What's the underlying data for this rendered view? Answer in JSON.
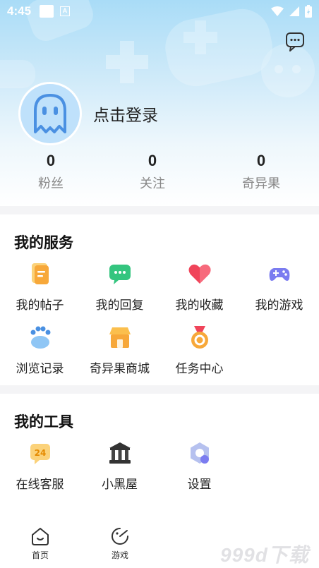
{
  "status_bar": {
    "time": "4:45",
    "notif_badge": "A"
  },
  "profile": {
    "login_text": "点击登录"
  },
  "stats": [
    {
      "value": "0",
      "label": "粉丝"
    },
    {
      "value": "0",
      "label": "关注"
    },
    {
      "value": "0",
      "label": "奇异果"
    }
  ],
  "services": {
    "title": "我的服务",
    "items": [
      {
        "label": "我的帖子",
        "icon": "posts-icon"
      },
      {
        "label": "我的回复",
        "icon": "reply-icon"
      },
      {
        "label": "我的收藏",
        "icon": "heart-icon"
      },
      {
        "label": "我的游戏",
        "icon": "gamepad-icon"
      },
      {
        "label": "浏览记录",
        "icon": "paw-icon"
      },
      {
        "label": "奇异果商城",
        "icon": "shop-icon"
      },
      {
        "label": "任务中心",
        "icon": "medal-icon"
      }
    ]
  },
  "tools": {
    "title": "我的工具",
    "items": [
      {
        "label": "在线客服",
        "icon": "24h-support-icon",
        "badge": "24"
      },
      {
        "label": "小黑屋",
        "icon": "building-icon"
      },
      {
        "label": "设置",
        "icon": "settings-icon"
      }
    ]
  },
  "tabbar": {
    "items": [
      {
        "label": "首页",
        "icon": "home-icon"
      },
      {
        "label": "游戏",
        "icon": "game-icon"
      }
    ]
  },
  "watermark": "999d下载",
  "colors": {
    "header_top": "#a9dcf7",
    "avatar_bg": "#bfe1fb",
    "icon_blue": "#4a90e2",
    "accent_orange": "#f7a83a",
    "accent_green": "#34c57f",
    "accent_red": "#f0445a",
    "accent_purple": "#7b7cf0"
  }
}
